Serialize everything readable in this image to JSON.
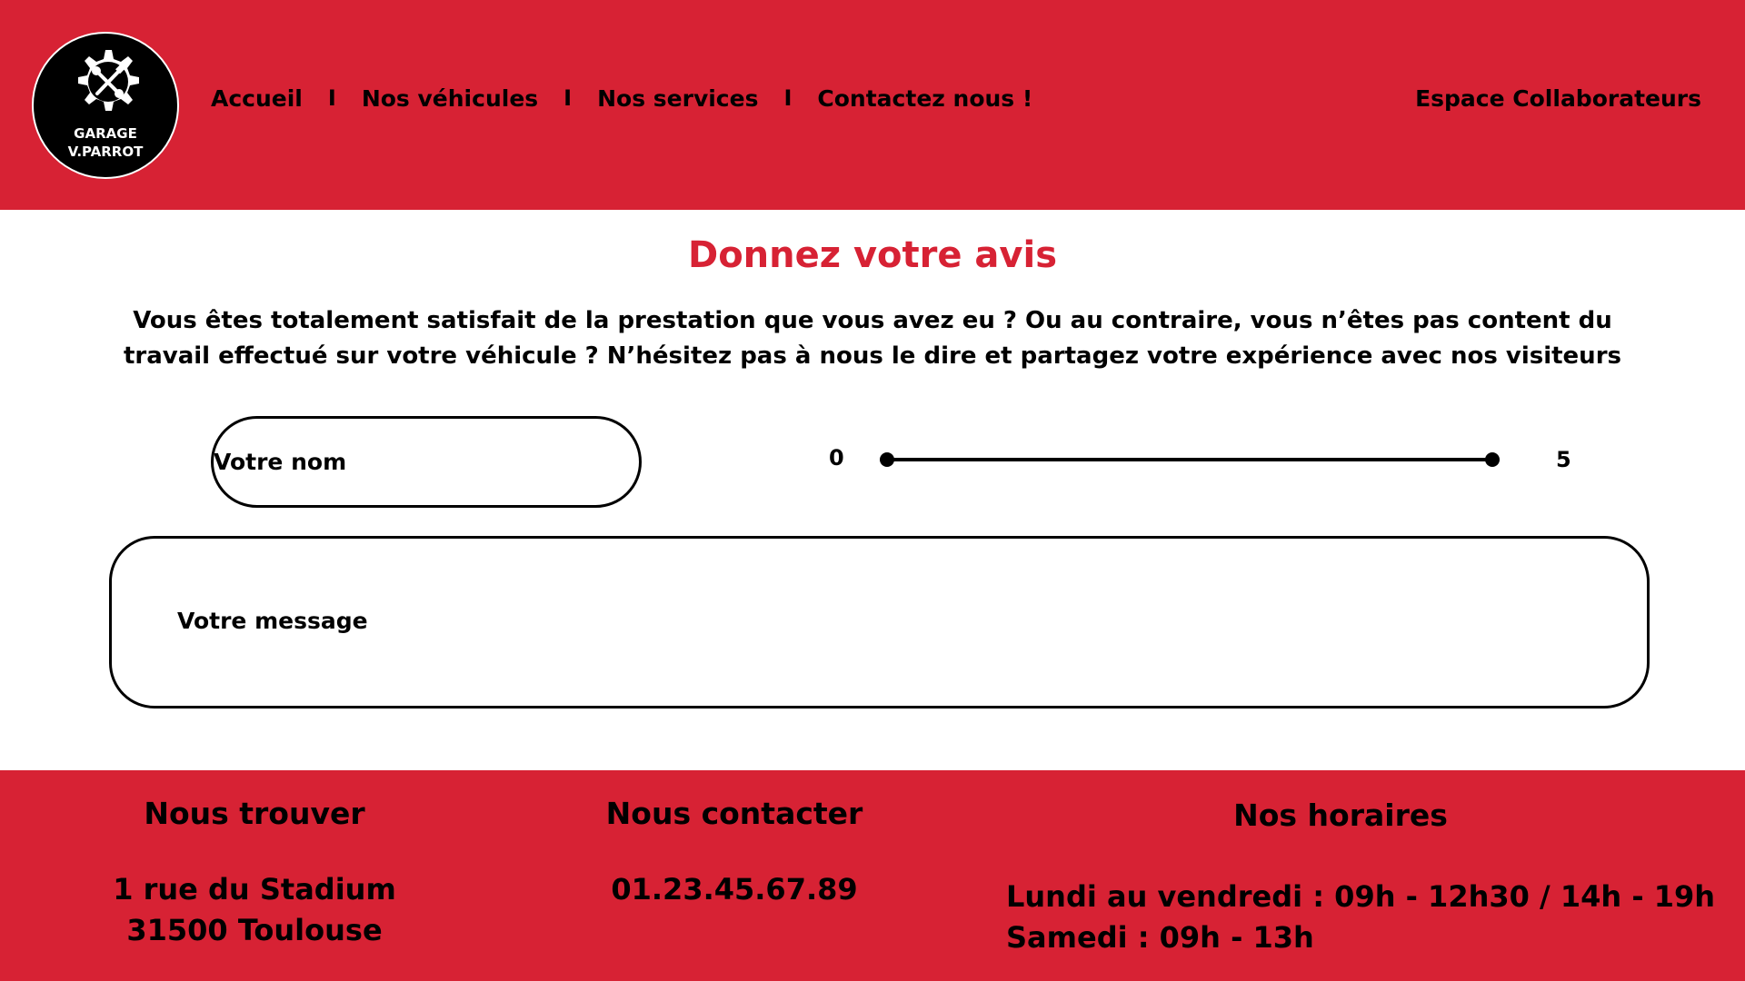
{
  "header": {
    "logo_text_line1": "GARAGE",
    "logo_text_line2": "V.PARROT",
    "logo_icon": "gear-wrench-screwdriver-icon",
    "nav": [
      {
        "label": "Accueil"
      },
      {
        "label": "Nos véhicules"
      },
      {
        "label": "Nos services"
      },
      {
        "label": "Contactez nous !"
      }
    ],
    "nav_separator": "I",
    "collab_label": "Espace Collaborateurs"
  },
  "main": {
    "title": "Donnez votre avis",
    "intro": "Vous êtes totalement satisfait de la prestation que vous avez eu ? Ou au contraire, vous n’êtes pas content du travail effectué sur votre véhicule ? N’hésitez pas à nous le dire et partagez votre expérience avec nos visiteurs",
    "name_placeholder": "Votre nom",
    "rating": {
      "min_label": "0",
      "max_label": "5",
      "min": 0,
      "max": 5
    },
    "message_placeholder": "Votre message"
  },
  "footer": {
    "find": {
      "title": "Nous trouver",
      "address_line1": "1 rue du Stadium",
      "address_line2": "31500 Toulouse"
    },
    "contact": {
      "title": "Nous contacter",
      "phone": "01.23.45.67.89"
    },
    "hours": {
      "title": "Nos horaires",
      "weekdays": "Lundi au vendredi : 09h - 12h30 / 14h - 19h",
      "saturday": "Samedi : 09h - 13h"
    }
  },
  "colors": {
    "brand_red": "#d72234",
    "black": "#000000",
    "white": "#ffffff"
  }
}
